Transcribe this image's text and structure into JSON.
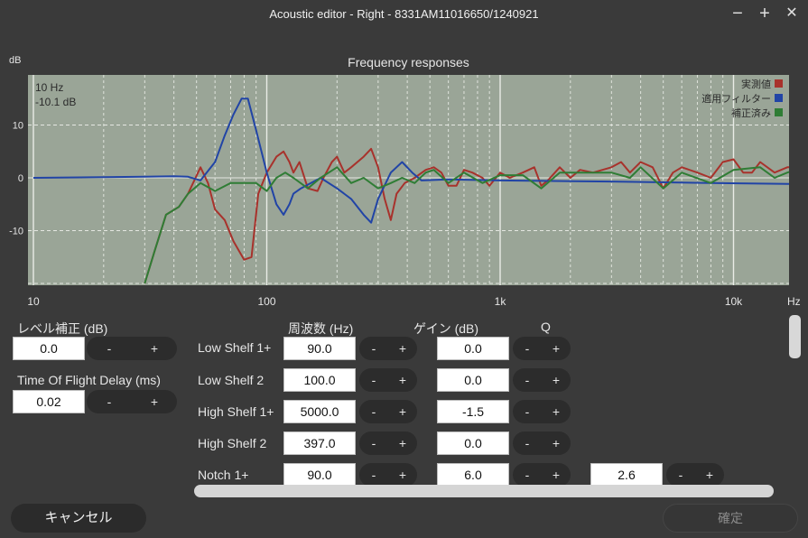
{
  "window": {
    "title": "Acoustic editor - Right - 8331AM11016650/1240921",
    "minimize": "−",
    "maximize": "+",
    "close": "✕"
  },
  "chart": {
    "title": "Frequency responses",
    "y_unit": "dB",
    "x_unit": "Hz",
    "cursor_freq": "10 Hz",
    "cursor_db": "-10.1 dB",
    "colors": {
      "plot_bg": "#9aa597",
      "measured": "#a8322c",
      "filter": "#2144a6",
      "corrected": "#2f7d35"
    }
  },
  "chart_data": {
    "type": "line",
    "title": "Frequency responses",
    "xlabel": "Hz",
    "ylabel": "dB",
    "x_scale": "log",
    "xlim": [
      10,
      20000
    ],
    "ylim": [
      -20,
      20
    ],
    "x_ticks": [
      "10",
      "100",
      "1k",
      "10k"
    ],
    "y_ticks": [
      "10",
      "0",
      "-10"
    ],
    "grid": true,
    "legend": "top-right",
    "series": [
      {
        "name": "実測値",
        "color": "#a8322c",
        "points": [
          [
            30,
            -20
          ],
          [
            33,
            -14
          ],
          [
            37,
            -7
          ],
          [
            42,
            -5.5
          ],
          [
            46,
            -3
          ],
          [
            52,
            2
          ],
          [
            56,
            -1
          ],
          [
            60,
            -6
          ],
          [
            66,
            -8
          ],
          [
            72,
            -12
          ],
          [
            80,
            -15.5
          ],
          [
            86,
            -15
          ],
          [
            92,
            -3
          ],
          [
            100,
            1
          ],
          [
            110,
            4
          ],
          [
            118,
            5
          ],
          [
            125,
            3
          ],
          [
            130,
            1
          ],
          [
            138,
            3
          ],
          [
            150,
            -2
          ],
          [
            165,
            -2.5
          ],
          [
            175,
            0
          ],
          [
            190,
            3
          ],
          [
            200,
            4
          ],
          [
            215,
            1
          ],
          [
            230,
            2
          ],
          [
            260,
            4
          ],
          [
            280,
            5.5
          ],
          [
            300,
            2
          ],
          [
            320,
            -4
          ],
          [
            340,
            -8
          ],
          [
            360,
            -3
          ],
          [
            390,
            -1
          ],
          [
            430,
            0
          ],
          [
            480,
            1.5
          ],
          [
            520,
            2
          ],
          [
            560,
            1
          ],
          [
            600,
            -1.5
          ],
          [
            650,
            -1.5
          ],
          [
            700,
            1.5
          ],
          [
            760,
            1
          ],
          [
            840,
            0
          ],
          [
            900,
            -1.5
          ],
          [
            1000,
            1
          ],
          [
            1100,
            0
          ],
          [
            1250,
            1
          ],
          [
            1400,
            2
          ],
          [
            1500,
            -1.5
          ],
          [
            1600,
            -0.5
          ],
          [
            1800,
            2
          ],
          [
            2000,
            0
          ],
          [
            2200,
            1.5
          ],
          [
            2500,
            1
          ],
          [
            3000,
            2
          ],
          [
            3300,
            3
          ],
          [
            3600,
            1
          ],
          [
            4000,
            3
          ],
          [
            4500,
            2
          ],
          [
            5000,
            -2
          ],
          [
            5500,
            1
          ],
          [
            6000,
            2
          ],
          [
            7000,
            1
          ],
          [
            8000,
            0
          ],
          [
            9000,
            3
          ],
          [
            10000,
            3.5
          ],
          [
            11000,
            1
          ],
          [
            12000,
            1
          ],
          [
            13000,
            3
          ],
          [
            15000,
            1
          ],
          [
            17000,
            2
          ],
          [
            19000,
            2
          ],
          [
            20000,
            4
          ]
        ]
      },
      {
        "name": "適用フィルター",
        "color": "#2144a6",
        "points": [
          [
            10,
            0
          ],
          [
            30,
            0.2
          ],
          [
            40,
            0.3
          ],
          [
            46,
            0.2
          ],
          [
            52,
            -0.5
          ],
          [
            60,
            3
          ],
          [
            66,
            8
          ],
          [
            72,
            12
          ],
          [
            78,
            15
          ],
          [
            83,
            15
          ],
          [
            90,
            9
          ],
          [
            100,
            1
          ],
          [
            110,
            -5
          ],
          [
            118,
            -7
          ],
          [
            125,
            -5
          ],
          [
            130,
            -3
          ],
          [
            140,
            -2
          ],
          [
            170,
            0
          ],
          [
            200,
            -2
          ],
          [
            230,
            -4
          ],
          [
            260,
            -7
          ],
          [
            280,
            -8.5
          ],
          [
            300,
            -4
          ],
          [
            340,
            1
          ],
          [
            380,
            3
          ],
          [
            420,
            1
          ],
          [
            460,
            -0.5
          ],
          [
            600,
            -0.3
          ],
          [
            1000,
            -0.5
          ],
          [
            3000,
            -0.7
          ],
          [
            8000,
            -1
          ],
          [
            20000,
            -1.2
          ]
        ]
      },
      {
        "name": "補正済み",
        "color": "#2f7d35",
        "points": [
          [
            30,
            -20
          ],
          [
            33,
            -14
          ],
          [
            37,
            -7
          ],
          [
            42,
            -5.5
          ],
          [
            46,
            -3
          ],
          [
            52,
            -1
          ],
          [
            60,
            -2.5
          ],
          [
            70,
            -1
          ],
          [
            80,
            -1
          ],
          [
            90,
            -1
          ],
          [
            100,
            -2.5
          ],
          [
            110,
            0
          ],
          [
            120,
            1
          ],
          [
            130,
            0
          ],
          [
            150,
            -2
          ],
          [
            170,
            0
          ],
          [
            200,
            2
          ],
          [
            230,
            -1
          ],
          [
            260,
            0
          ],
          [
            300,
            -2
          ],
          [
            340,
            -1
          ],
          [
            380,
            0
          ],
          [
            430,
            -1
          ],
          [
            480,
            1
          ],
          [
            520,
            1.5
          ],
          [
            600,
            -1
          ],
          [
            700,
            1
          ],
          [
            840,
            -1
          ],
          [
            1000,
            0.5
          ],
          [
            1250,
            0.5
          ],
          [
            1500,
            -2
          ],
          [
            1800,
            1
          ],
          [
            2200,
            1
          ],
          [
            3000,
            1
          ],
          [
            3600,
            0
          ],
          [
            4000,
            2
          ],
          [
            5000,
            -2
          ],
          [
            6000,
            1
          ],
          [
            8000,
            -1
          ],
          [
            10000,
            1.5
          ],
          [
            13000,
            2
          ],
          [
            15000,
            0
          ],
          [
            17000,
            1
          ],
          [
            20000,
            2
          ]
        ]
      }
    ]
  },
  "left_panel": {
    "level_label": "レベル補正 (dB)",
    "level_value": "0.0",
    "tof_label": "Time Of Flight Delay (ms)",
    "tof_value": "0.02",
    "minus": "-",
    "plus": "+"
  },
  "filters": {
    "col_freq": "周波数 (Hz)",
    "col_gain": "ゲイン (dB)",
    "col_q": "Q",
    "minus": "-",
    "plus": "+",
    "rows": [
      {
        "name": "Low Shelf 1+",
        "freq": "90.0",
        "gain": "0.0"
      },
      {
        "name": "Low Shelf 2",
        "freq": "100.0",
        "gain": "0.0"
      },
      {
        "name": "High Shelf 1+",
        "freq": "5000.0",
        "gain": "-1.5"
      },
      {
        "name": "High Shelf 2",
        "freq": "397.0",
        "gain": "0.0"
      },
      {
        "name": "Notch 1+",
        "freq": "90.0",
        "gain": "6.0",
        "q": "2.6"
      }
    ]
  },
  "footer": {
    "cancel": "キャンセル",
    "confirm": "確定"
  }
}
